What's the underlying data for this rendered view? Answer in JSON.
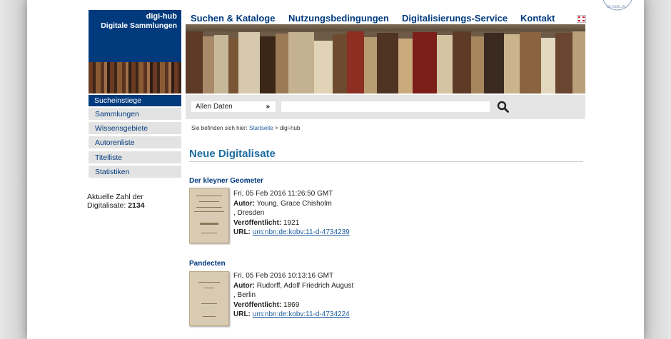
{
  "brand": {
    "title": "digi-hub",
    "subtitle": "Digitale Sammlungen"
  },
  "nav": [
    "Suchen & Kataloge",
    "Nutzungsbedingungen",
    "Digitalisierungs-Service",
    "Kontakt"
  ],
  "sidebar": {
    "active": "Sucheinstiege",
    "items": [
      "Sammlungen",
      "Wissensgebiete",
      "Autorenliste",
      "Titelliste",
      "Statistiken"
    ],
    "count_label": "Aktuelle Zahl der Digitalisate:",
    "count_value": "2134"
  },
  "search": {
    "select_value": "Allen Daten",
    "input_value": ""
  },
  "breadcrumb": {
    "prefix": "Sie befinden sich hier:",
    "home": "Startseite",
    "separator": ">",
    "current": "digi-hub"
  },
  "heading": "Neue Digitalisate",
  "entries": [
    {
      "title": "Der kleyner Geometer",
      "date": "Fri, 05 Feb 2016 11:26:50 GMT",
      "author_label": "Autor:",
      "author": "Young, Grace Chisholm",
      "place": ", Dresden",
      "published_label": "Veröffentlicht:",
      "published": "1921",
      "url_label": "URL:",
      "url": "urn:nbn:de:kobv:11-d-4734239"
    },
    {
      "title": "Pandecten",
      "date": "Fri, 05 Feb 2016 10:13:16 GMT",
      "author_label": "Autor:",
      "author": "Rudorff, Adolf Friedrich August",
      "place": ", Berlin",
      "published_label": "Veröffentlicht:",
      "published": "1869",
      "url_label": "URL:",
      "url": "urn:nbn:de:kobv:11-d-4734224"
    }
  ],
  "icons": {
    "search": "search-icon",
    "select": "chevron-down-icon",
    "flag": "uk-flag-icon",
    "seal": "university-seal-icon"
  }
}
